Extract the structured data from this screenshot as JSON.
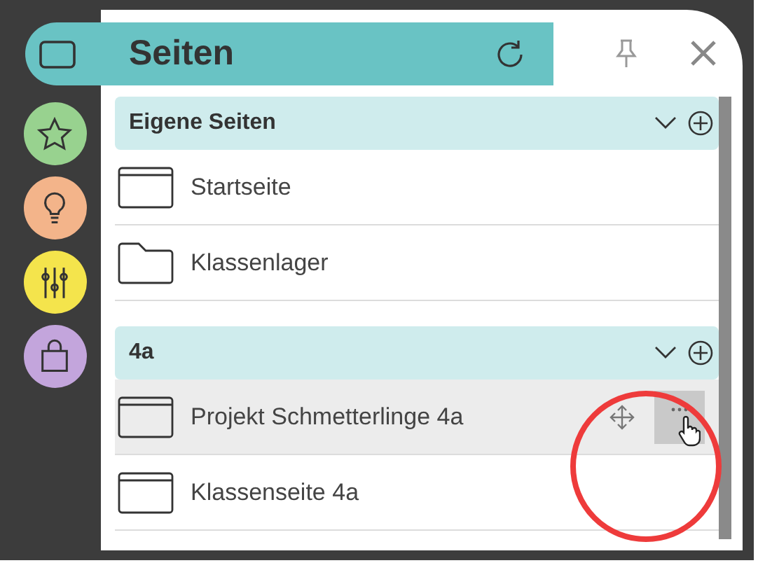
{
  "header": {
    "title": "Seiten"
  },
  "sidebar": {
    "items": [
      {
        "kind": "star",
        "color": "#98d28f"
      },
      {
        "kind": "bulb",
        "color": "#f3b48a"
      },
      {
        "kind": "sliders",
        "color": "#f4e44c"
      },
      {
        "kind": "bag",
        "color": "#c3a5dc"
      }
    ]
  },
  "sections": [
    {
      "title": "Eigene Seiten",
      "items": [
        {
          "kind": "page",
          "label": "Startseite",
          "hovered": false
        },
        {
          "kind": "folder",
          "label": "Klassenlager",
          "hovered": false
        }
      ]
    },
    {
      "title": "4a",
      "items": [
        {
          "kind": "page",
          "label": "Projekt Schmetterlinge 4a",
          "hovered": true
        },
        {
          "kind": "page",
          "label": "Klassenseite 4a",
          "hovered": false
        }
      ]
    }
  ]
}
